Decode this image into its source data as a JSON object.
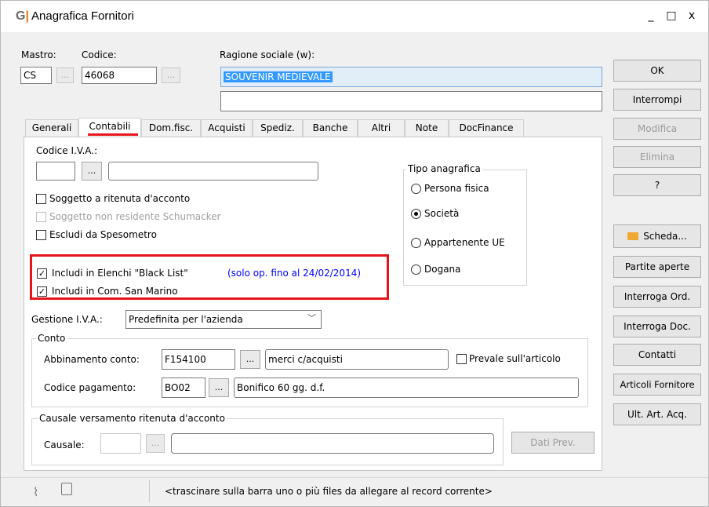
{
  "window": {
    "logo": "G",
    "title": "Anagrafica Fornitori",
    "controls": {
      "minimize": "_",
      "maximize": "□",
      "close": "x"
    }
  },
  "header": {
    "mastro_label": "Mastro:",
    "mastro_value": "CS",
    "codice_label": "Codice:",
    "codice_value": "46068",
    "ragione_label": "Ragione sociale (w):",
    "ragione_value": "SOUVENIR MEDIEVALE",
    "ragione_value2": "",
    "dots": "..."
  },
  "tabs": [
    {
      "label": "Generali"
    },
    {
      "label": "Contabili"
    },
    {
      "label": "Dom.fisc."
    },
    {
      "label": "Acquisti"
    },
    {
      "label": "Spediz."
    },
    {
      "label": "Banche"
    },
    {
      "label": "Altri"
    },
    {
      "label": "Note"
    },
    {
      "label": "DocFinance"
    }
  ],
  "contabili": {
    "iva_label": "Codice I.V.A.:",
    "iva_code": "",
    "iva_desc": "",
    "checks": {
      "soggetto_ritenuta": {
        "label": "Soggetto a ritenuta d'acconto",
        "checked": false
      },
      "non_residente": {
        "label": "Soggetto non residente Schumacker",
        "checked": false
      },
      "spesometro": {
        "label": "Escludi da Spesometro",
        "checked": false
      },
      "black_list": {
        "label": "Includi in Elenchi \"Black List\"",
        "checked": true
      },
      "san_marino": {
        "label": "Includi in Com. San Marino",
        "checked": true
      }
    },
    "black_list_note": "(solo op. fino al 24/02/2014)",
    "tipo_anagrafica": {
      "title": "Tipo anagrafica",
      "options": [
        {
          "label": "Persona fisica",
          "selected": false
        },
        {
          "label": "Società",
          "selected": true
        },
        {
          "label": "Appartenente UE",
          "selected": false
        },
        {
          "label": "Dogana",
          "selected": false
        }
      ]
    },
    "gestione_iva_label": "Gestione I.V.A.:",
    "gestione_iva_value": "Predefinita per l'azienda",
    "conto": {
      "title": "Conto",
      "abbinamento_label": "Abbinamento conto:",
      "abbinamento_code": "F154100",
      "abbinamento_desc": "merci c/acquisti",
      "prevale_label": "Prevale sull'articolo",
      "prevale_checked": false,
      "pagamento_label": "Codice pagamento:",
      "pagamento_code": "BO02",
      "pagamento_desc": "Bonifico 60 gg. d.f."
    },
    "causale": {
      "title": "Causale versamento ritenuta d'acconto",
      "label": "Causale:",
      "code": "",
      "desc": "",
      "dati_prev": "Dati Prev."
    }
  },
  "side_buttons": {
    "ok": "OK",
    "interrompi": "Interrompi",
    "modifica": "Modifica",
    "elimina": "Elimina",
    "help": "?",
    "scheda": "Scheda...",
    "partite": "Partite aperte",
    "int_ord": "Interroga Ord.",
    "int_doc": "Interroga Doc.",
    "contatti": "Contatti",
    "articoli": "Articoli Fornitore",
    "ult_art": "Ult. Art. Acq."
  },
  "status_bar": {
    "hint": "<trascinare sulla barra uno o più files da allegare al record corrente>"
  },
  "colors": {
    "highlight_border": "#e8141c",
    "selection_bg": "#3399ff",
    "note_text": "#0000ff",
    "folder_icon": "#f0a830"
  }
}
